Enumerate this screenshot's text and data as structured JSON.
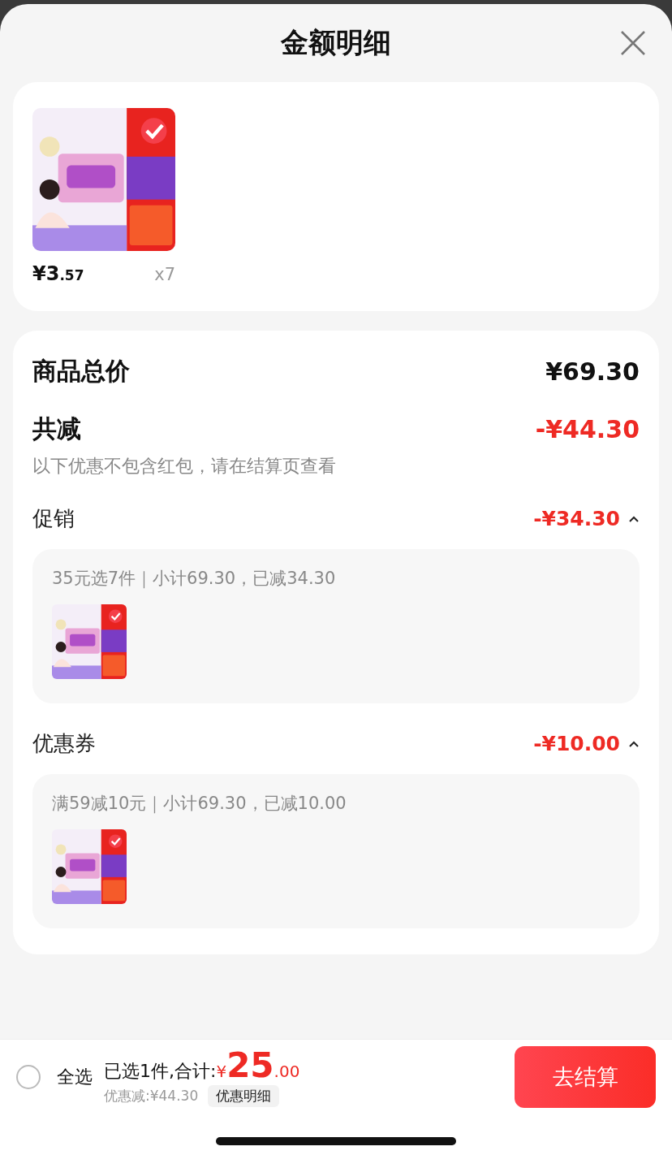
{
  "sheet": {
    "title": "金额明细"
  },
  "products": [
    {
      "price_main": "¥3",
      "price_decimal": ".57",
      "quantity": "x7"
    }
  ],
  "summary": {
    "total_label": "商品总价",
    "total_value": "¥69.30",
    "reduce_label": "共减",
    "reduce_value": "-¥44.30",
    "note": "以下优惠不包含红包，请在结算页查看"
  },
  "discounts": [
    {
      "label": "促销",
      "value": "-¥34.30",
      "expanded": true,
      "detail": "35元选7件｜小计69.30，已减34.30"
    },
    {
      "label": "优惠券",
      "value": "-¥10.00",
      "expanded": true,
      "detail": "满59减10元｜小计69.30，已减10.00"
    }
  ],
  "bottom_bar": {
    "select_all": {
      "label": "全选",
      "checked": false
    },
    "selected_text": "已选1件,合计:",
    "currency": "¥",
    "total_main": "25",
    "total_decimal": ".00",
    "discount_text": "优惠减:¥44.30",
    "detail_button": "优惠明细",
    "checkout_button": "去结算"
  }
}
